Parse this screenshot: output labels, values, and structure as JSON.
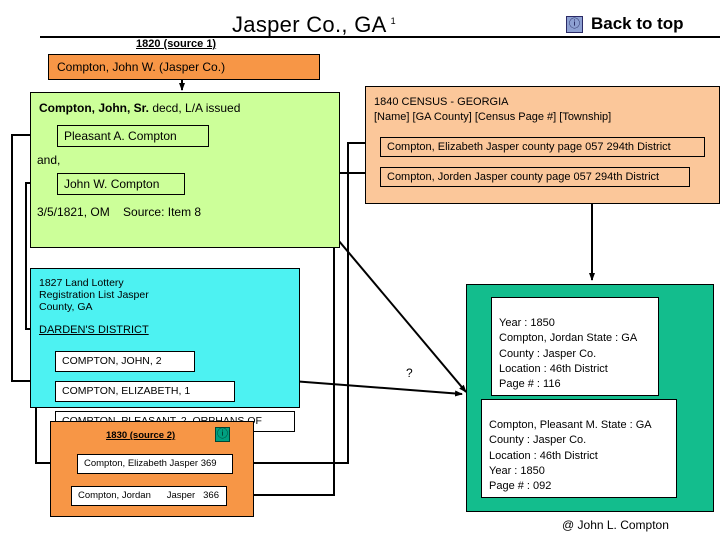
{
  "header": {
    "title": "Jasper Co., GA",
    "title_superscript": "1",
    "back_to_top_label": "Back to top",
    "back_to_top_icon": "info-circle-icon",
    "source1_label": "1820 (source 1)"
  },
  "box_1820": {
    "entry": "Compton, John W. (Jasper Co.)",
    "color": "#f79646"
  },
  "estate_box": {
    "color": "#ccff99",
    "heading_bold": "Compton, John, Sr.",
    "heading_rest": " decd, L/A issued",
    "child_1": "Pleasant A. Compton",
    "and_label": "and,",
    "child_2": "John W. Compton",
    "footer": "3/5/1821, OM    Source: Item 8"
  },
  "lottery_box": {
    "color": "#4df2f2",
    "title": "1827 Land Lottery\nRegistration List Jasper\nCounty, GA",
    "district": "DARDEN'S DISTRICT",
    "entries": [
      "COMPTON, JOHN, 2",
      "COMPTON, ELIZABETH, 1",
      "COMPTON, PLEASANT, 2, ORPHANS OF"
    ]
  },
  "box_1830": {
    "color": "#f79646",
    "label": "1830 (source 2)",
    "icon": "info-circle-icon",
    "rows": [
      "Compton, Elizabeth  Jasper 369",
      "Compton, Jordan      Jasper   366"
    ]
  },
  "census_1840": {
    "color": "#fbc79a",
    "heading": "1840 CENSUS - GEORGIA\n[Name] [GA County] [Census Page #] [Township]",
    "rows": [
      "Compton, Elizabeth Jasper county page 057 294th District",
      "Compton, Jorden Jasper county page 057 294th District"
    ]
  },
  "census_1850": {
    "color": "#13bd8d",
    "record_jordan": "Year : 1850\nCompton, Jordan State : GA\nCounty : Jasper Co.\nLocation : 46th District\nPage # : 116",
    "record_pleasant": "Compton, Pleasant M. State : GA\nCounty : Jasper Co.\nLocation : 46th District\nYear : 1850\nPage # : 092"
  },
  "annotations": {
    "question_mark": "?"
  },
  "footer": {
    "credit": "@ John L. Compton"
  }
}
